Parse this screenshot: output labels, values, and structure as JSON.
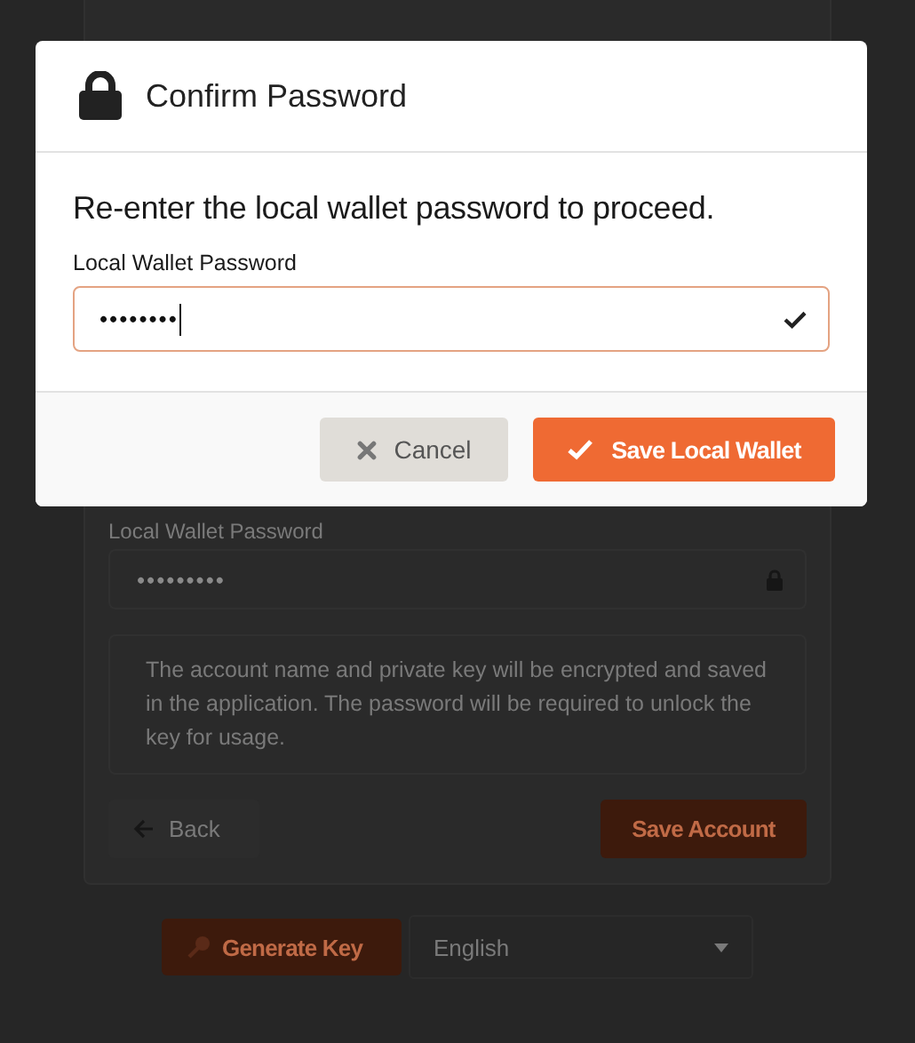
{
  "background_form": {
    "password_label": "Local Wallet Password",
    "password_value": "•••••••••",
    "info": "The account name and private key will be encrypted and saved in the application. The password will be required to unlock the key for usage.",
    "back_button": "Back",
    "save_button": "Save Account"
  },
  "bottom_bar": {
    "generate_button": "Generate Key",
    "language_select": "English"
  },
  "dialog": {
    "title": "Confirm Password",
    "prompt": "Re-enter the local wallet password to proceed.",
    "field_label": "Local Wallet Password",
    "field_value": "••••••••",
    "valid": true,
    "buttons": [
      {
        "label": "Cancel",
        "kind": "secondary"
      },
      {
        "label": "Save Local Wallet",
        "kind": "primary"
      }
    ]
  }
}
